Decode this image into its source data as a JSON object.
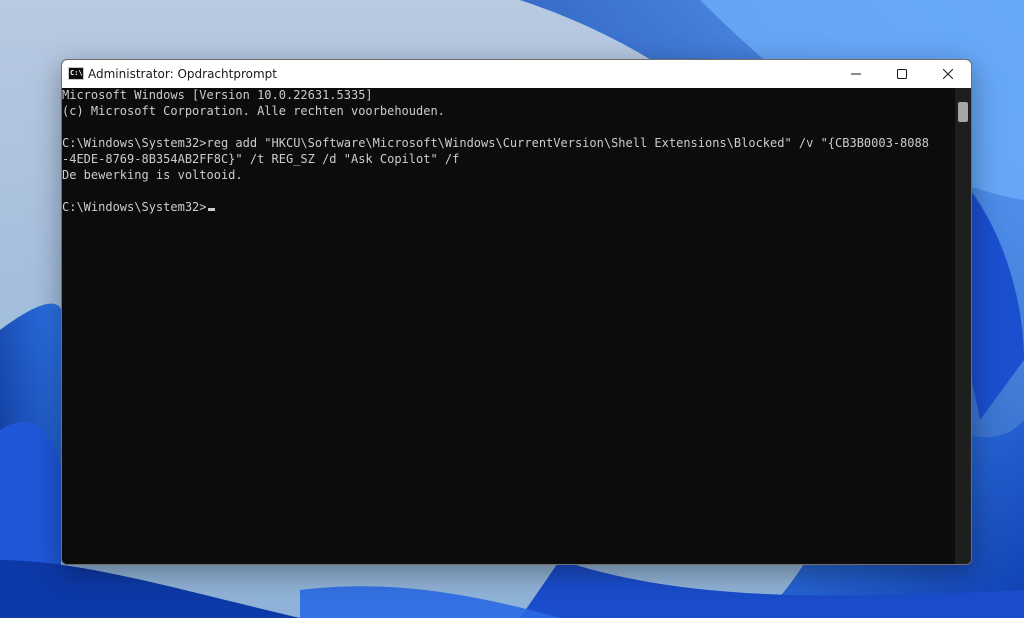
{
  "window": {
    "title": "Administrator: Opdrachtprompt",
    "app_icon_text": "C:\\",
    "icon": "command-prompt-icon"
  },
  "controls": {
    "minimize_icon": "minimize-icon",
    "maximize_icon": "maximize-icon",
    "close_icon": "close-icon"
  },
  "console": {
    "lines": [
      "Microsoft Windows [Version 10.0.22631.5335]",
      "(c) Microsoft Corporation. Alle rechten voorbehouden.",
      "",
      "C:\\Windows\\System32>reg add \"HKCU\\Software\\Microsoft\\Windows\\CurrentVersion\\Shell Extensions\\Blocked\" /v \"{CB3B0003-8088",
      "-4EDE-8769-8B354AB2FF8C}\" /t REG_SZ /d \"Ask Copilot\" /f",
      "De bewerking is voltooid.",
      "",
      "C:\\Windows\\System32>"
    ]
  },
  "colors": {
    "console_bg": "#0c0c0c",
    "console_text": "#cccccc",
    "titlebar_bg": "#ffffff",
    "wallpaper_blue": "#1d5fe0"
  }
}
